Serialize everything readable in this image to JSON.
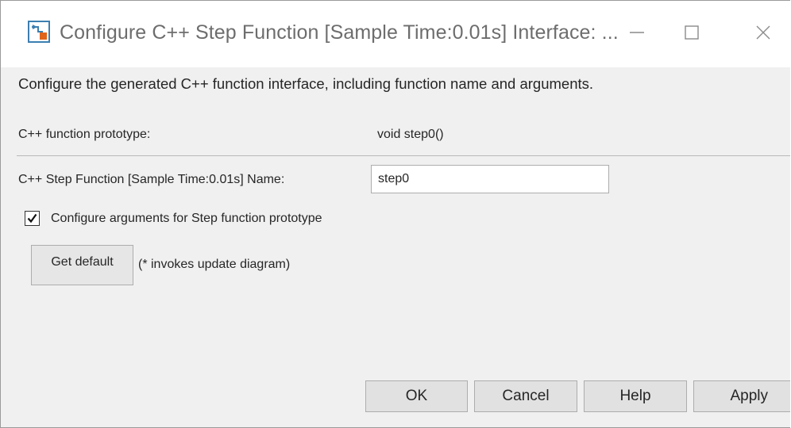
{
  "window": {
    "title": "Configure C++ Step Function [Sample Time:0.01s] Interface: ...",
    "icon": "simulink-model-icon",
    "controls": {
      "minimize": "minimize-icon",
      "maximize": "maximize-icon",
      "close": "close-icon"
    }
  },
  "dialog": {
    "description": "Configure the generated C++ function interface, including function name and arguments.",
    "prototype": {
      "label": "C++ function prototype:",
      "value": "void step0()"
    },
    "function_name": {
      "label": "C++ Step Function [Sample Time:0.01s] Name:",
      "value": "step0"
    },
    "configure_arguments": {
      "label": "Configure arguments for Step function prototype",
      "checked": true
    },
    "get_default": {
      "label": "Get default",
      "note": "(* invokes update diagram)"
    }
  },
  "footer": {
    "ok_label": "OK",
    "cancel_label": "Cancel",
    "help_label": "Help",
    "apply_label": "Apply"
  }
}
